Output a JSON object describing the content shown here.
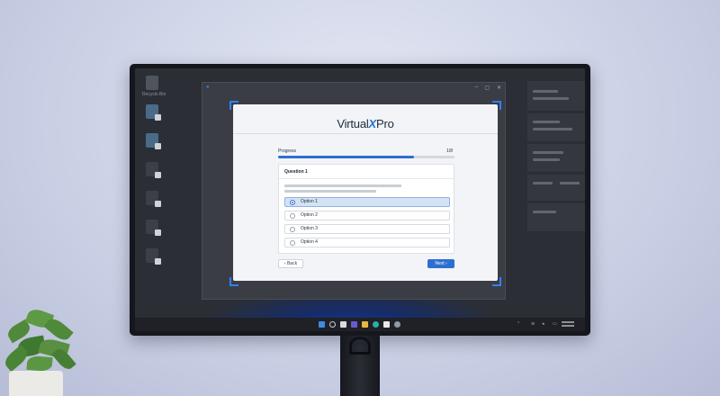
{
  "desktop": {
    "recycle_bin_label": "Recycle Bin"
  },
  "app": {
    "brand_left": "Virtual",
    "brand_x": "X",
    "brand_right": "Pro",
    "accent_color": "#2d6fd1",
    "window_controls": {
      "minimize": "–",
      "maximize": "▢",
      "close": "✕"
    }
  },
  "quiz": {
    "progress_label": "Progress",
    "progress_count": "1/8",
    "progress_fraction": 0.77,
    "question_title": "Question 1",
    "options": [
      {
        "label": "Option 1",
        "selected": true
      },
      {
        "label": "Option 2",
        "selected": false
      },
      {
        "label": "Option 3",
        "selected": false
      },
      {
        "label": "Option 4",
        "selected": false
      }
    ],
    "back_label": "‹ Back",
    "next_label": "Next ›"
  },
  "taskbar": {
    "icons": [
      "windows-start-icon",
      "search-icon",
      "task-view-icon",
      "chat-icon",
      "file-explorer-icon",
      "edge-icon",
      "store-icon",
      "settings-icon"
    ]
  }
}
